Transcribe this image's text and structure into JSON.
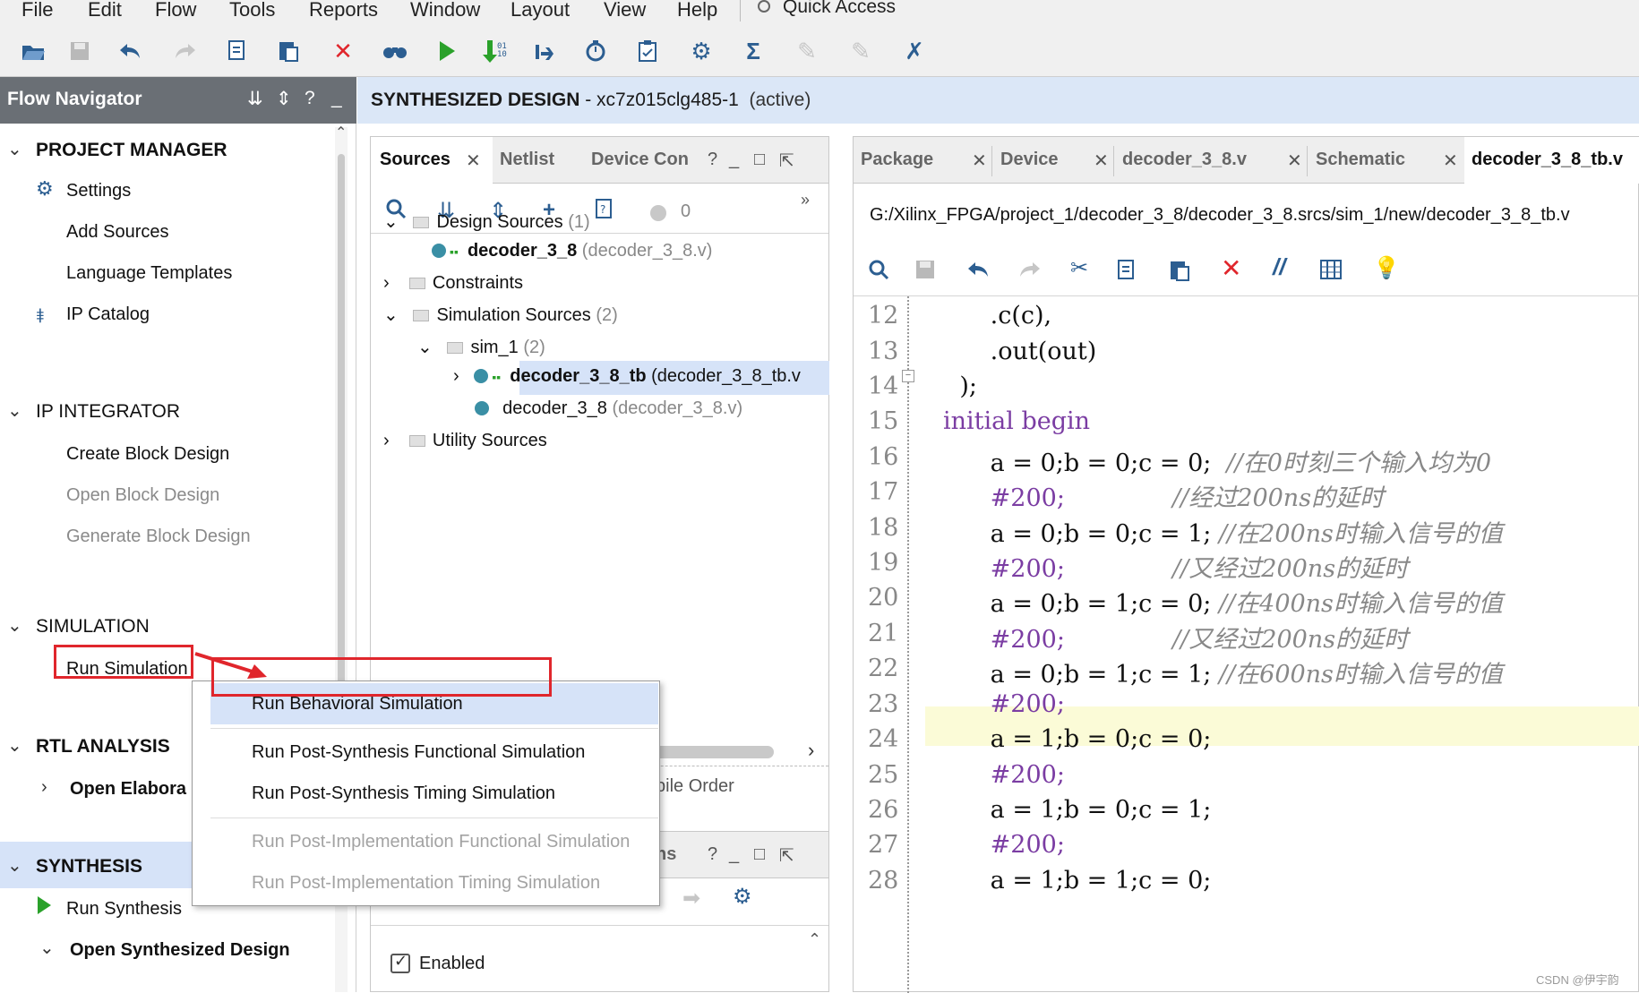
{
  "menubar": {
    "items": [
      "File",
      "Edit",
      "Flow",
      "Tools",
      "Reports",
      "Window",
      "Layout",
      "View",
      "Help"
    ],
    "quick_access": "Quick Access"
  },
  "toolbar": {
    "icons": [
      "open-project-icon",
      "save-icon",
      "undo-icon",
      "redo-icon",
      "copy-icon",
      "paste-icon",
      "delete-icon",
      "find-icon",
      "run-icon",
      "step-icon",
      "restart-icon",
      "timer-icon",
      "report-icon",
      "settings-icon",
      "sum-icon",
      "disabled-tool-icon",
      "disabled-tool2-icon",
      "debug-icon"
    ]
  },
  "flow_navigator": {
    "title": "Flow Navigator",
    "sections": {
      "project_manager": "PROJECT MANAGER",
      "settings": "Settings",
      "add_sources": "Add Sources",
      "language_templates": "Language Templates",
      "ip_catalog": "IP Catalog",
      "ip_integrator": "IP INTEGRATOR",
      "create_block": "Create Block Design",
      "open_block": "Open Block Design",
      "generate_block": "Generate Block Design",
      "simulation": "SIMULATION",
      "run_simulation": "Run Simulation",
      "rtl_analysis": "RTL ANALYSIS",
      "open_elaborated": "Open Elabora",
      "synthesis": "SYNTHESIS",
      "run_synthesis": "Run Synthesis",
      "open_synthesized": "Open Synthesized Design"
    }
  },
  "design_header": {
    "label": "SYNTHESIZED DESIGN",
    "part": " - xc7z015clg485-1",
    "state": "(active)"
  },
  "sources": {
    "tabs": [
      "Sources",
      "Netlist",
      "Device Con"
    ],
    "count": "0",
    "tree": {
      "design_sources": "Design Sources",
      "design_sources_count": "(1)",
      "decoder_top": "decoder_3_8",
      "decoder_top_file": "(decoder_3_8.v)",
      "constraints": "Constraints",
      "sim_sources": "Simulation Sources",
      "sim_sources_count": "(2)",
      "sim_1": "sim_1",
      "sim_1_count": "(2)",
      "tb": "decoder_3_8_tb",
      "tb_file": "(decoder_3_8_tb.v",
      "decoder_sim": "decoder_3_8",
      "decoder_sim_file": "(decoder_3_8.v)",
      "utility_sources": "Utility Sources"
    },
    "compile_order_fragment": "pile Order"
  },
  "bottom_panel": {
    "tab_fragment": "ns",
    "enabled_label": "Enabled"
  },
  "editor": {
    "tabs": [
      "Package",
      "Device",
      "decoder_3_8.v",
      "Schematic",
      "decoder_3_8_tb.v"
    ],
    "path": "G:/Xilinx_FPGA/project_1/decoder_3_8/decoder_3_8.srcs/sim_1/new/decoder_3_8_tb.v",
    "lines": [
      {
        "n": "12",
        "code": "        .c(c),",
        "comment": ""
      },
      {
        "n": "13",
        "code": "        .out(out)",
        "comment": ""
      },
      {
        "n": "14",
        "code": "    );",
        "comment": ""
      },
      {
        "n": "15",
        "code": "",
        "comment": ""
      },
      {
        "n": "16",
        "code": "        a = 0;b = 0;c = 0;",
        "comment": "  //在0时刻三个输入均为0"
      },
      {
        "n": "17",
        "code": "        #200;",
        "comment": "              //经过200ns的延时"
      },
      {
        "n": "18",
        "code": "        a = 0;b = 0;c = 1;",
        "comment": " //在200ns时输入信号的值"
      },
      {
        "n": "19",
        "code": "        #200;",
        "comment": "              //又经过200ns的延时"
      },
      {
        "n": "20",
        "code": "        a = 0;b = 1;c = 0;",
        "comment": " //在400ns时输入信号的值"
      },
      {
        "n": "21",
        "code": "        #200;",
        "comment": "              //又经过200ns的延时"
      },
      {
        "n": "22",
        "code": "        a = 0;b = 1;c = 1;",
        "comment": " //在600ns时输入信号的值"
      },
      {
        "n": "23",
        "code": "        #200;",
        "comment": ""
      },
      {
        "n": "24",
        "code": "        a = 1;b = 0;c = 0;",
        "comment": ""
      },
      {
        "n": "25",
        "code": "        #200;",
        "comment": ""
      },
      {
        "n": "26",
        "code": "        a = 1;b = 0;c = 1;",
        "comment": ""
      },
      {
        "n": "27",
        "code": "        #200;",
        "comment": ""
      },
      {
        "n": "28",
        "code": "        a = 1;b = 1;c = 0;",
        "comment": ""
      }
    ],
    "initial_kw": "initial",
    "begin_kw": "begin"
  },
  "context_menu": {
    "items": [
      {
        "label": "Run Behavioral Simulation",
        "enabled": true
      },
      {
        "label": "Run Post-Synthesis Functional Simulation",
        "enabled": true
      },
      {
        "label": "Run Post-Synthesis Timing Simulation",
        "enabled": true
      },
      {
        "label": "Run Post-Implementation Functional Simulation",
        "enabled": false
      },
      {
        "label": "Run Post-Implementation Timing Simulation",
        "enabled": false
      }
    ]
  },
  "colors": {
    "accent_blue": "#2c5e91",
    "header_blue": "#dbe7f7",
    "annotation_red": "#e0262c",
    "nav_header": "#6a6f75",
    "highlight_line": "#fbfbd7"
  },
  "watermark": "CSDN @伊宇韵"
}
